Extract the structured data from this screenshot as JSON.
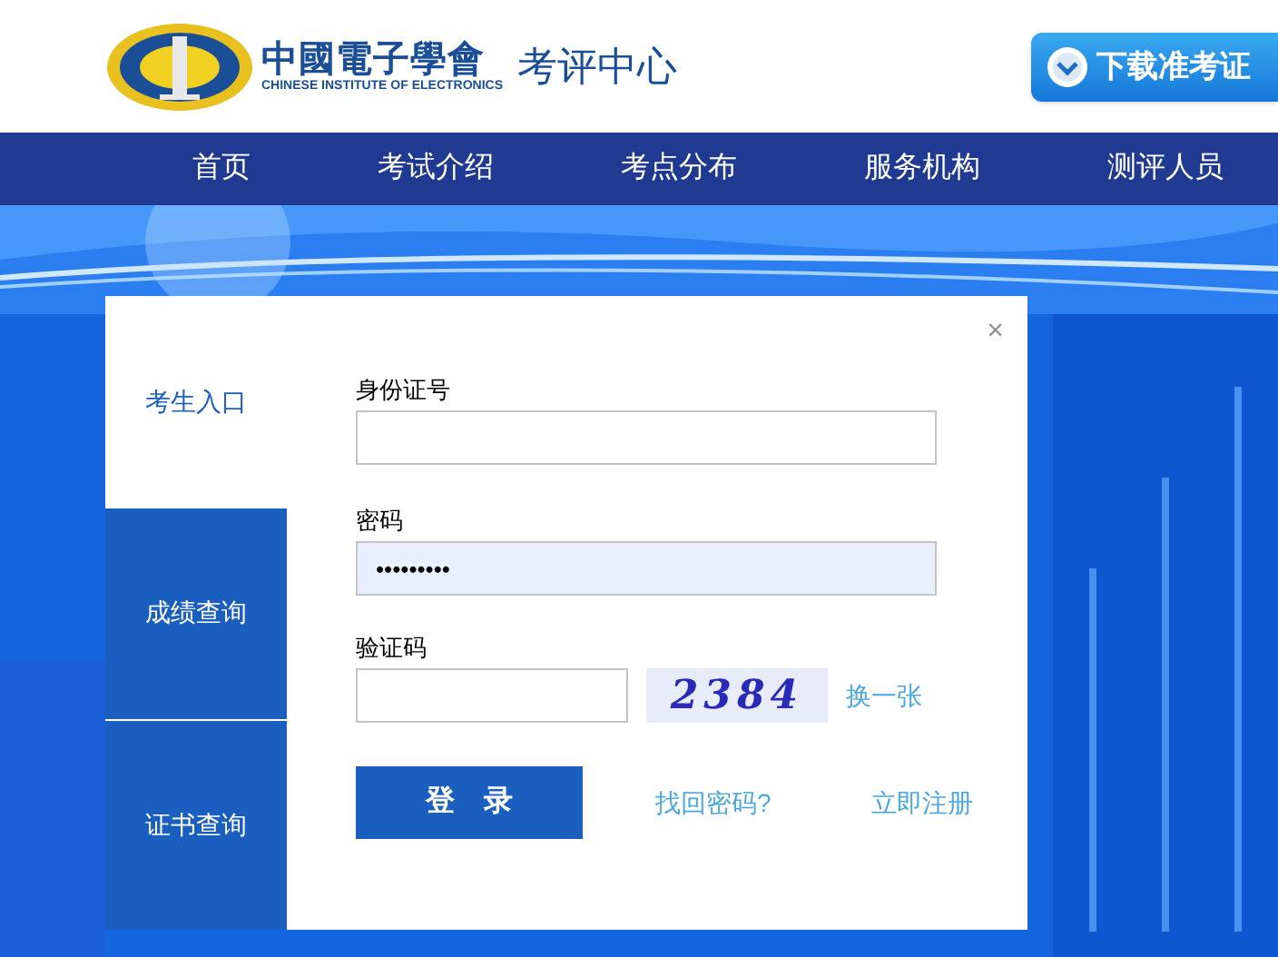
{
  "header": {
    "logo_title": "中國電子學會",
    "logo_subtitle": "CHINESE INSTITUTE OF ELECTRONICS",
    "site_name": "考评中心",
    "download_button": "下载准考证"
  },
  "nav": {
    "items": [
      {
        "label": "首页"
      },
      {
        "label": "考试介绍"
      },
      {
        "label": "考点分布"
      },
      {
        "label": "服务机构"
      },
      {
        "label": "测评人员"
      }
    ]
  },
  "login_dialog": {
    "close": "×",
    "tabs": [
      {
        "label": "考生入口",
        "selected": true
      },
      {
        "label": "成绩查询",
        "selected": false
      },
      {
        "label": "证书查询",
        "selected": false
      }
    ],
    "fields": [
      {
        "label": "身份证号",
        "autofilled": false
      },
      {
        "label": "密码",
        "value": "•••••••••",
        "autofilled": true
      }
    ],
    "captcha": {
      "label": "验证码",
      "image_text": "2384",
      "refresh_link": "换一张"
    },
    "login_button": "登　录",
    "forgot_link": "找回密码?",
    "register_link": "立即注册"
  }
}
